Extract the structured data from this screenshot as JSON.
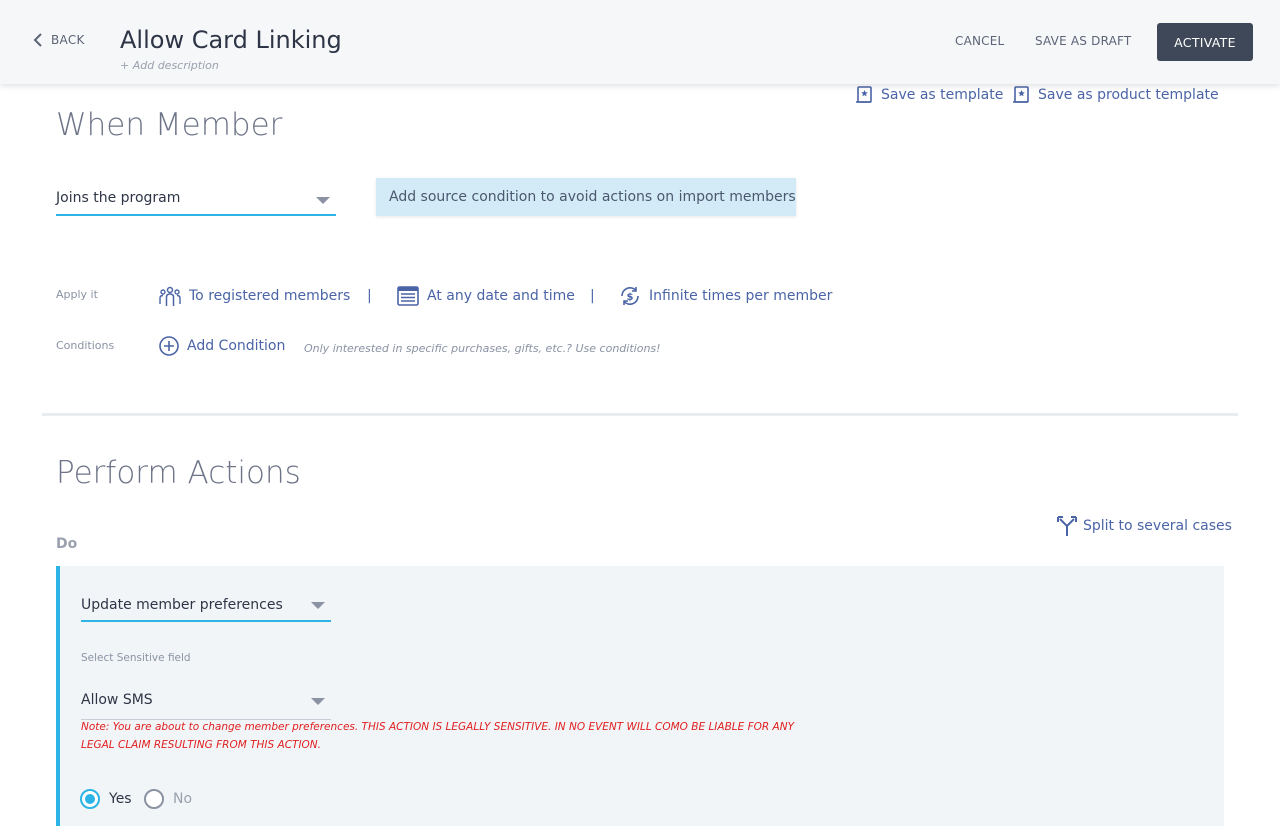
{
  "header": {
    "back_label": "BACK",
    "title": "Allow Card Linking",
    "add_description": "+ Add description",
    "cancel_label": "CANCEL",
    "save_draft_label": "SAVE AS DRAFT",
    "activate_label": "ACTIVATE"
  },
  "templates": {
    "save_template": "Save as template",
    "save_product_template": "Save as product template"
  },
  "when": {
    "title": "When Member",
    "trigger_value": "Joins the program",
    "hint": "Add source condition to avoid actions on import members",
    "apply_label": "Apply it",
    "apply_items": [
      "To registered members",
      "At any date and time",
      "Infinite times per member"
    ],
    "separator": "|",
    "conditions_label": "Conditions",
    "add_condition": "Add Condition",
    "conditions_hint": "Only interested in specific purchases, gifts, etc.? Use conditions!"
  },
  "perform": {
    "title": "Perform Actions",
    "split_label": "Split to several cases",
    "do_label": "Do",
    "action_value": "Update member preferences",
    "sensitive_label": "Select Sensitive field",
    "sensitive_value": "Allow SMS",
    "note": "Note: You are about to change member preferences. THIS ACTION IS LEGALLY SENSITIVE. IN NO EVENT WILL COMO BE LIABLE FOR ANY LEGAL CLAIM RESULTING FROM THIS ACTION.",
    "radio_yes": "Yes",
    "radio_no": "No",
    "selected": "Yes"
  },
  "colors": {
    "accent": "#2bb4e5",
    "link": "#4a64a6",
    "activate_bg": "#3f4859",
    "warning": "#e02020"
  }
}
